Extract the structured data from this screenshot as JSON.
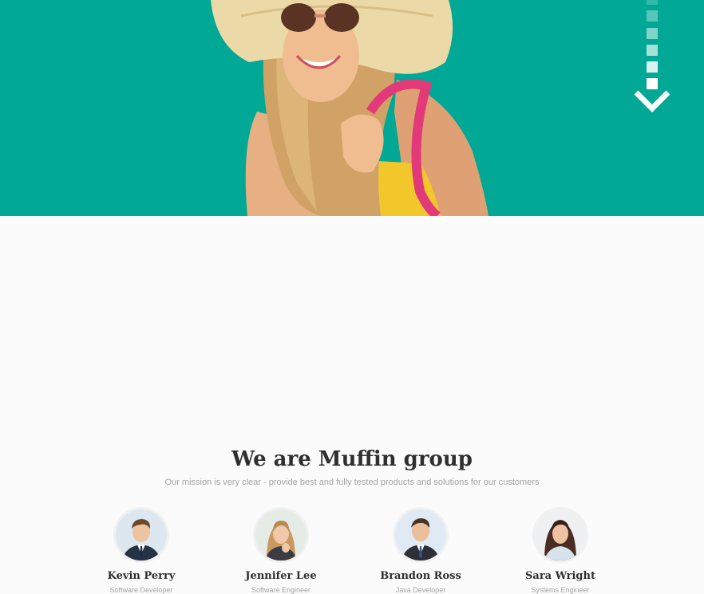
{
  "hero": {
    "accent_color": "#00a895",
    "photo_icon": "woman-sun-hat-photo",
    "scroll_icon": "scroll-down-arrow-icon"
  },
  "about": {
    "title": "We are Muffin group",
    "subtitle": "Our mission is very clear - provide best and fully tested products and solutions for our customers"
  },
  "team": [
    {
      "name": "Kevin Perry",
      "role": "Software Developer"
    },
    {
      "name": "Jennifer Lee",
      "role": "Software Engineer"
    },
    {
      "name": "Brandon Ross",
      "role": "Java Developer"
    },
    {
      "name": "Sara Wright",
      "role": "Systems Engineer"
    }
  ]
}
